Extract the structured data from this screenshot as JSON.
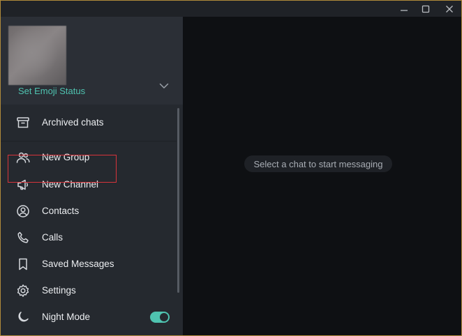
{
  "window": {
    "controls": [
      {
        "name": "minimize-icon"
      },
      {
        "name": "maximize-icon"
      },
      {
        "name": "close-icon"
      }
    ]
  },
  "profile": {
    "emoji_status": "Set Emoji Status",
    "expand_icon": "chevron-down-icon"
  },
  "menu": {
    "archived": {
      "label": "Archived chats",
      "icon": "archive-icon"
    },
    "new_group": {
      "label": "New Group",
      "icon": "group-icon"
    },
    "new_channel": {
      "label": "New Channel",
      "icon": "megaphone-icon"
    },
    "contacts": {
      "label": "Contacts",
      "icon": "contact-icon"
    },
    "calls": {
      "label": "Calls",
      "icon": "phone-icon"
    },
    "saved": {
      "label": "Saved Messages",
      "icon": "bookmark-icon"
    },
    "settings": {
      "label": "Settings",
      "icon": "gear-icon"
    },
    "night_mode": {
      "label": "Night Mode",
      "icon": "moon-icon",
      "enabled": true
    }
  },
  "main": {
    "placeholder": "Select a chat to start messaging"
  },
  "colors": {
    "accent": "#4fc3b0",
    "highlight_border": "#d8343b",
    "sidebar_bg": "#25292f",
    "main_bg": "#0e1013"
  }
}
